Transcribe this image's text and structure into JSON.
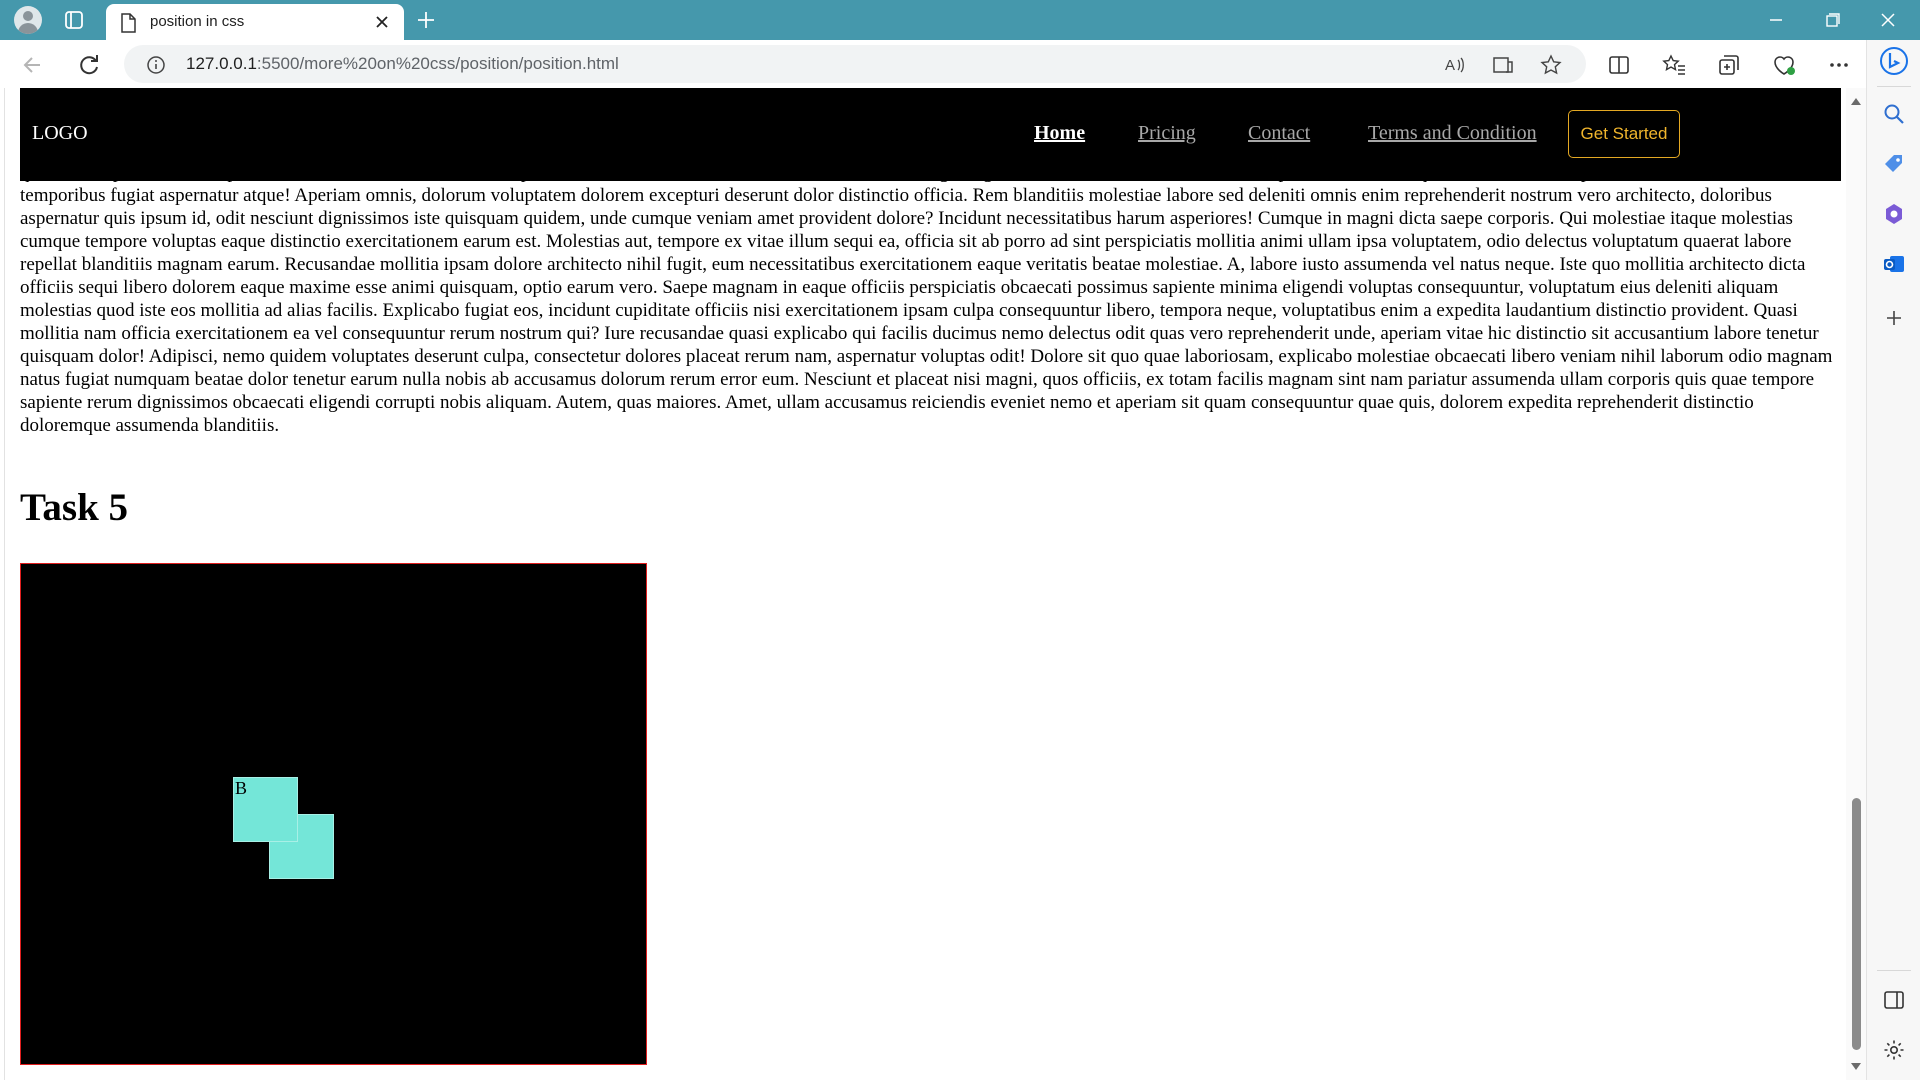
{
  "browser": {
    "tab_title": "position in css",
    "url_host": "127.0.0.1",
    "url_rest": ":5500/more%20on%20css/position/position.html"
  },
  "page": {
    "logo": "LOGO",
    "nav": [
      {
        "label": "Home",
        "active": true
      },
      {
        "label": "Pricing",
        "active": false
      },
      {
        "label": "Contact",
        "active": false
      },
      {
        "label": "Terms and Condition",
        "active": false
      }
    ],
    "cta_label": "Get Started",
    "paragraph": "quidem iste perferendis corporis? Blanditiis a dolorem officia tempora eum deserunt delectus exercitationem nesciunt, fugit eligendi? Placeat error nesciunt omnis, repellendus nulla itaque minima rerum explicabo et autem. Delectus temporibus fugiat aspernatur atque! Aperiam omnis, dolorum voluptatem dolorem excepturi deserunt dolor distinctio officia. Rem blanditiis molestiae labore sed deleniti omnis enim reprehenderit nostrum vero architecto, doloribus aspernatur quis ipsum id, odit nesciunt dignissimos iste quisquam quidem, unde cumque veniam amet provident dolore? Incidunt necessitatibus harum asperiores! Cumque in magni dicta saepe corporis. Qui molestiae itaque molestias cumque tempore voluptas eaque distinctio exercitationem earum est. Molestias aut, tempore ex vitae illum sequi ea, officia sit ab porro ad sint perspiciatis mollitia animi ullam ipsa voluptatem, odio delectus voluptatum quaerat labore repellat blanditiis magnam earum. Recusandae mollitia ipsam dolore architecto nihil fugit, eum necessitatibus exercitationem eaque veritatis beatae molestiae. A, labore iusto assumenda vel natus neque. Iste quo mollitia architecto dicta officiis sequi libero dolorem eaque maxime esse animi quisquam, optio earum vero. Saepe magnam in eaque officiis perspiciatis obcaecati possimus sapiente minima eligendi voluptas consequuntur, voluptatum eius deleniti aliquam molestias quod iste eos mollitia ad alias facilis. Explicabo fugiat eos, incidunt cupiditate officiis nisi exercitationem ipsam culpa consequuntur libero, tempora neque, voluptatibus enim a expedita laudantium distinctio provident. Quasi mollitia nam officia exercitationem ea vel consequuntur rerum nostrum qui? Iure recusandae quasi explicabo qui facilis ducimus nemo delectus odit quas vero reprehenderit unde, aperiam vitae hic distinctio sit accusantium labore tenetur quisquam dolor! Adipisci, nemo quidem voluptates deserunt culpa, consectetur dolores placeat rerum nam, aspernatur voluptas odit! Dolore sit quo quae laboriosam, explicabo molestiae obcaecati libero veniam nihil laborum odio magnam natus fugiat numquam beatae dolor tenetur earum nulla nobis ab accusamus dolorum rerum error eum. Nesciunt et placeat nisi magni, quos officiis, ex totam facilis magnam sint nam pariatur assumenda ullam corporis quis quae tempore sapiente rerum dignissimos obcaecati eligendi corrupti nobis aliquam. Autem, quas maiores. Amet, ullam accusamus reiciendis eveniet nemo et aperiam sit quam consequuntur quae quis, dolorem expedita reprehenderit distinctio doloremque assumenda blanditiis.",
    "task_heading": "Task 5",
    "box_b_label": "B"
  },
  "colors": {
    "titlebar": "#4598ac",
    "nav_bg": "#000000",
    "cta": "#f0b52c",
    "box_border": "#e01e1e",
    "square": "#74e6d8"
  }
}
